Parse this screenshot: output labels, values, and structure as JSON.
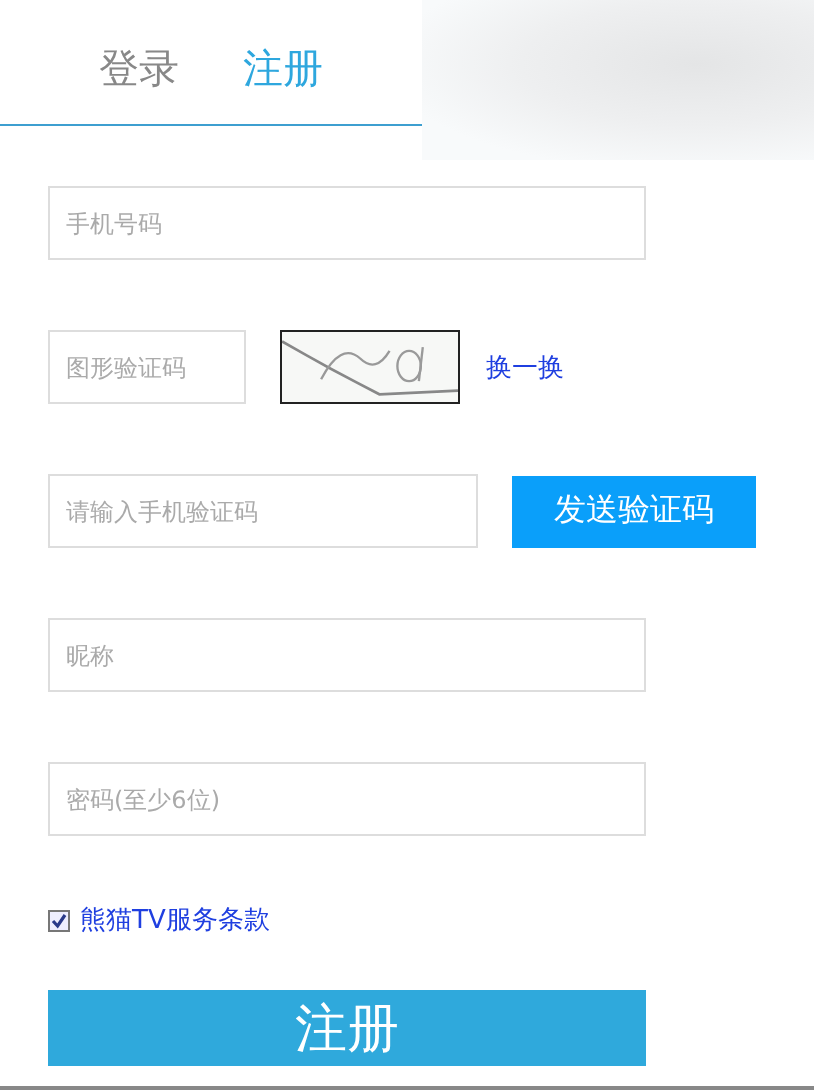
{
  "tabs": [
    {
      "label": "登录",
      "selected": false
    },
    {
      "label": "注册",
      "selected": true
    }
  ],
  "fields": [
    {
      "kind": "text",
      "placeholder": "手机号码"
    },
    {
      "kind": "captcha",
      "placeholder": "图形验证码",
      "refresh": "换一换"
    },
    {
      "kind": "sms",
      "placeholder": "请输入手机验证码",
      "button": "发送验证码"
    },
    {
      "kind": "text",
      "placeholder": "昵称"
    },
    {
      "kind": "text",
      "placeholder": "密码(至少6位)"
    }
  ],
  "agreement": {
    "label": "熊猫TV服务条款",
    "checked": true
  },
  "submit": "注册"
}
